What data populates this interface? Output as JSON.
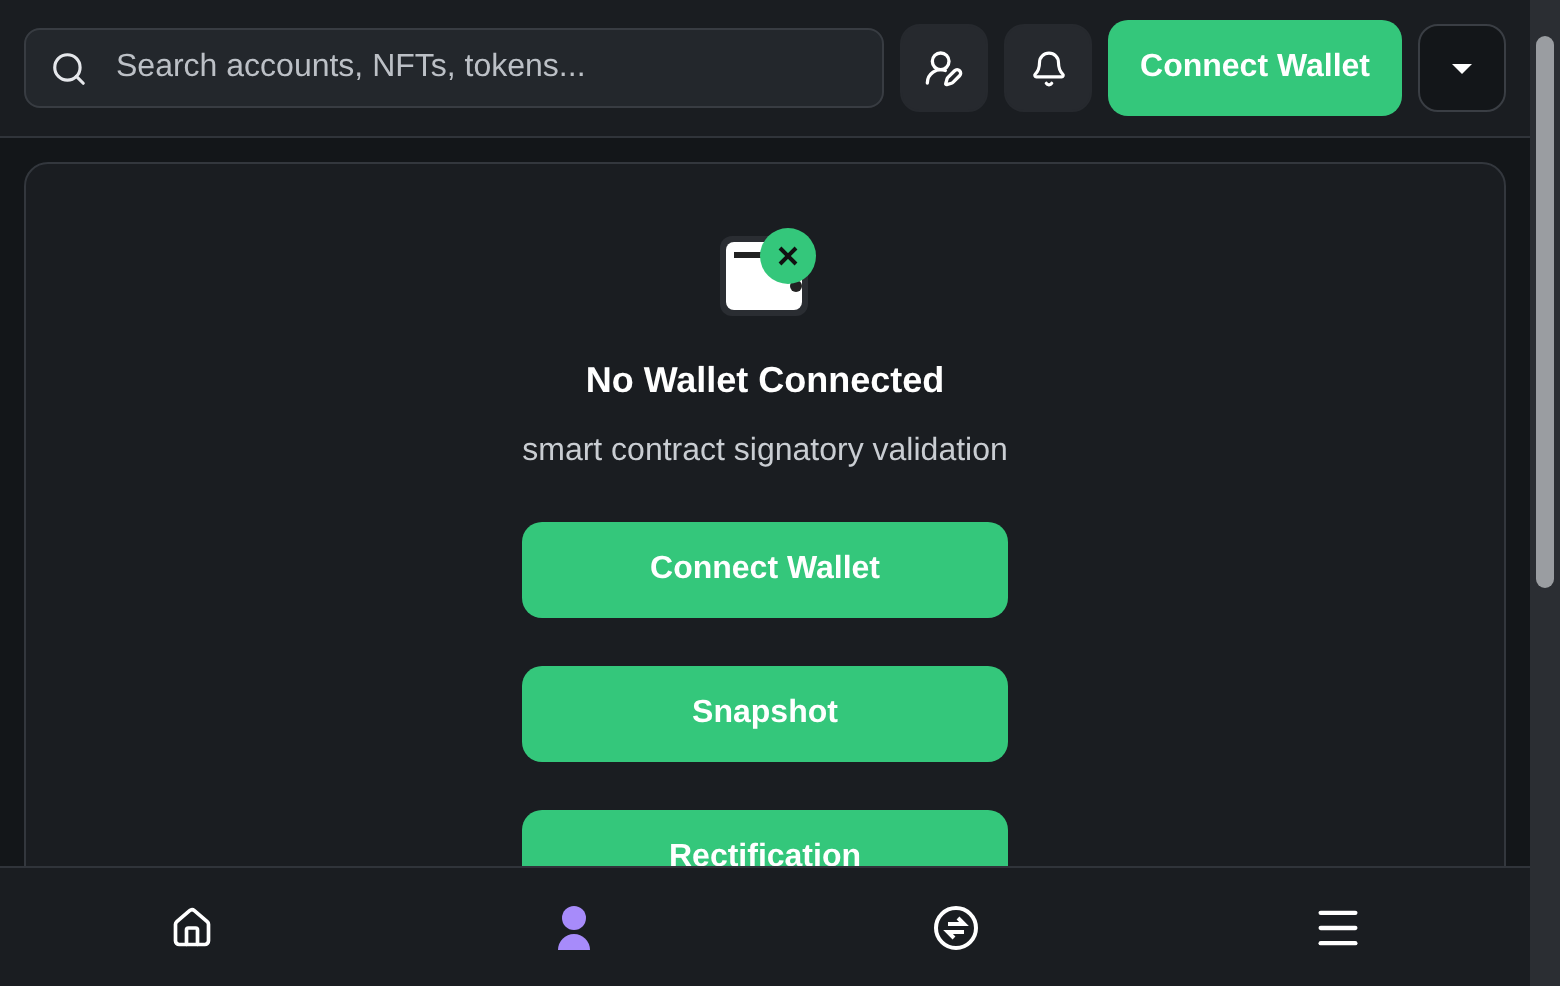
{
  "header": {
    "search": {
      "placeholder": "Search accounts, NFTs, tokens..."
    },
    "connect_button": "Connect Wallet"
  },
  "empty_state": {
    "title": "No Wallet Connected",
    "subtitle": "smart contract signatory validation",
    "actions": [
      "Connect Wallet",
      "Snapshot",
      "Rectification"
    ]
  },
  "bottom_nav": [
    {
      "kind": "home",
      "selected": false
    },
    {
      "kind": "profile",
      "selected": true
    },
    {
      "kind": "swap",
      "selected": false
    },
    {
      "kind": "menu",
      "selected": false
    }
  ]
}
